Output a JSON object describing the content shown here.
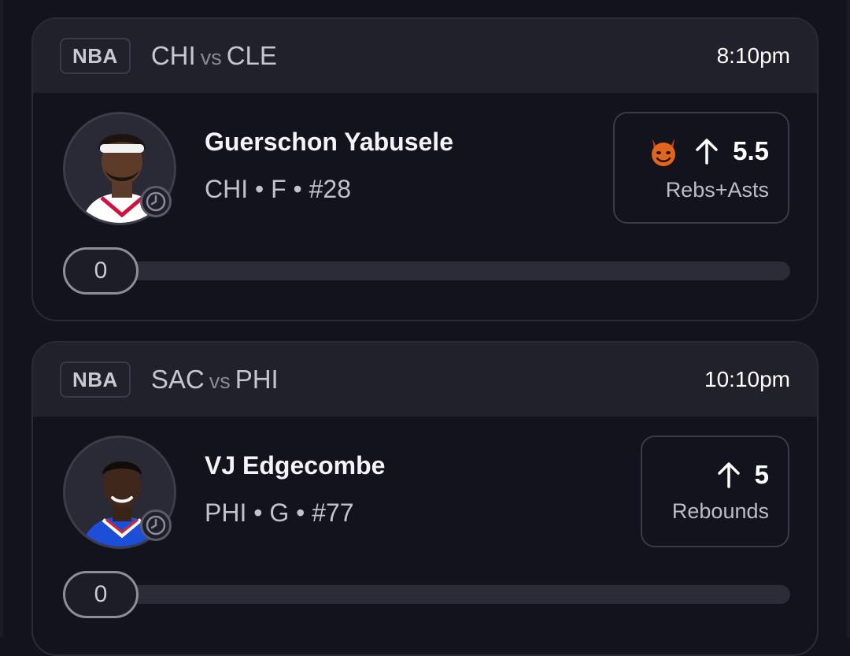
{
  "cards": [
    {
      "league": "NBA",
      "team_home": "CHI",
      "vs": "vs",
      "team_away": "CLE",
      "time": "8:10pm",
      "player": {
        "name": "Guerschon Yabusele",
        "info": "CHI • F • #28",
        "jersey_color": "#ffffff",
        "jersey_trim": "#ce1141"
      },
      "prop": {
        "direction_icon": "arrow-up-icon",
        "badge_icon": "demon-icon",
        "value": "5.5",
        "stat": "Rebs+Asts"
      },
      "progress": {
        "current": "0",
        "fraction": 0
      }
    },
    {
      "league": "NBA",
      "team_home": "SAC",
      "vs": "vs",
      "team_away": "PHI",
      "time": "10:10pm",
      "player": {
        "name": "VJ Edgecombe",
        "info": "PHI • G • #77",
        "jersey_color": "#1d4ed8",
        "jersey_trim": "#ffffff"
      },
      "prop": {
        "direction_icon": "arrow-up-icon",
        "value": "5",
        "stat": "Rebounds"
      },
      "progress": {
        "current": "0",
        "fraction": 0
      }
    }
  ],
  "colors": {
    "background": "#13131d",
    "header": "#21212c",
    "border": "#2b2b38",
    "accent_demon": "#e0661e"
  }
}
